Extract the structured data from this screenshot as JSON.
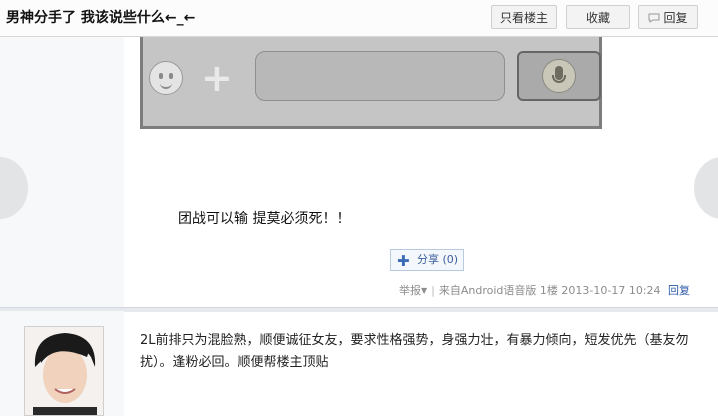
{
  "header": {
    "title": "男神分手了 我该说些什么←_←",
    "only_op_label": "只看楼主",
    "favorite_label": "收藏",
    "reply_label": "回复"
  },
  "post": {
    "text": "团战可以输 提莫必须死！！",
    "share_label": "分享",
    "share_count": "(0)",
    "report_label": "举报",
    "source": "来自Android语音版",
    "floor": "1楼",
    "datetime": "2013-10-17 10:24",
    "reply_link": "回复"
  },
  "reply": {
    "text": "2L前排只为混脸熟，顺便诚征女友，要求性格强势，身强力壮，有暴力倾向，短发优先（基友勿扰）。逢粉必回。顺便帮楼主顶贴"
  },
  "icons": [
    "smiley-icon",
    "plus-icon",
    "microphone-icon",
    "reply-bubble-icon",
    "share-plus-icon",
    "caret-down-icon"
  ],
  "colors": {
    "link_blue": "#2f5aa8",
    "meta_gray": "#8c8c8c",
    "sidebar_bg": "#f6f8fa"
  }
}
